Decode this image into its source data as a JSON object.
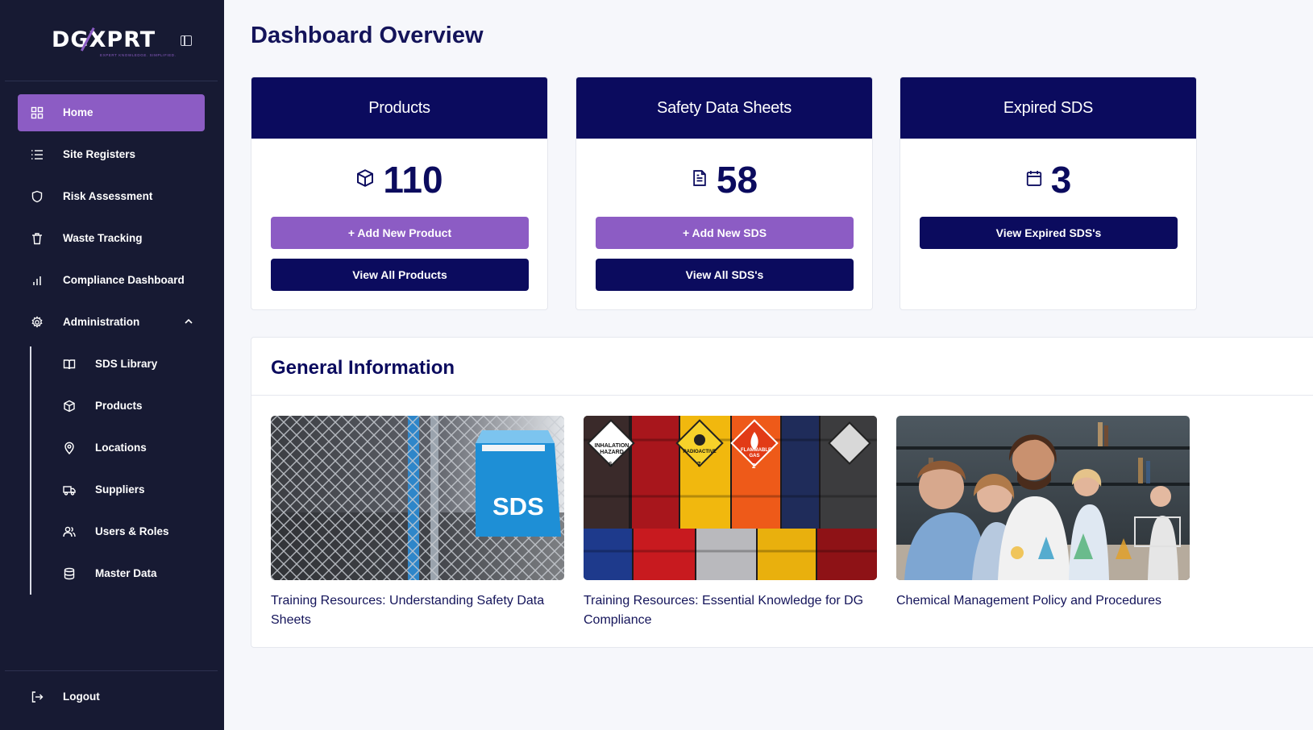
{
  "brand": {
    "logo_pre": "DG",
    "logo_x": "X",
    "logo_post": "PRT",
    "tagline": "EXPERT KNOWLEDGE. SIMPLIFIED."
  },
  "sidebar": {
    "items": [
      {
        "label": "Home",
        "icon": "grid-icon"
      },
      {
        "label": "Site Registers",
        "icon": "list-icon"
      },
      {
        "label": "Risk Assessment",
        "icon": "shield-icon"
      },
      {
        "label": "Waste Tracking",
        "icon": "trash-icon"
      },
      {
        "label": "Compliance Dashboard",
        "icon": "bar-chart-icon"
      },
      {
        "label": "Administration",
        "icon": "gear-icon"
      }
    ],
    "sub_items": [
      {
        "label": "SDS Library",
        "icon": "book-icon"
      },
      {
        "label": "Products",
        "icon": "box-icon"
      },
      {
        "label": "Locations",
        "icon": "map-pin-icon"
      },
      {
        "label": "Suppliers",
        "icon": "truck-icon"
      },
      {
        "label": "Users & Roles",
        "icon": "users-icon"
      },
      {
        "label": "Master Data",
        "icon": "database-icon"
      }
    ],
    "logout": "Logout"
  },
  "main": {
    "title": "Dashboard Overview",
    "cards": [
      {
        "title": "Products",
        "count": "110",
        "icon": "box-icon",
        "primary": "+ Add New Product",
        "secondary": "View All Products"
      },
      {
        "title": "Safety Data Sheets",
        "count": "58",
        "icon": "document-icon",
        "primary": "+ Add New SDS",
        "secondary": "View All SDS's"
      },
      {
        "title": "Expired SDS",
        "count": "3",
        "icon": "calendar-icon",
        "secondary": "View Expired SDS's"
      }
    ],
    "general": {
      "title": "General Information",
      "resources": [
        {
          "title": "Training Resources: Understanding Safety Data Sheets",
          "thumb_text": "SDS"
        },
        {
          "title": "Training Resources: Essential Knowledge for DG Compliance",
          "labels": [
            "INHALATION HAZARD",
            "6",
            "RADIOACTIVE",
            "7",
            "FLAMMABLE GAS",
            "2"
          ]
        },
        {
          "title": "Chemical Management Policy and Procedures"
        }
      ]
    }
  },
  "colors": {
    "sidebar_bg": "#171a33",
    "accent": "#8c5cc4",
    "navy": "#0b0b5e",
    "page_bg": "#f6f7fb"
  }
}
